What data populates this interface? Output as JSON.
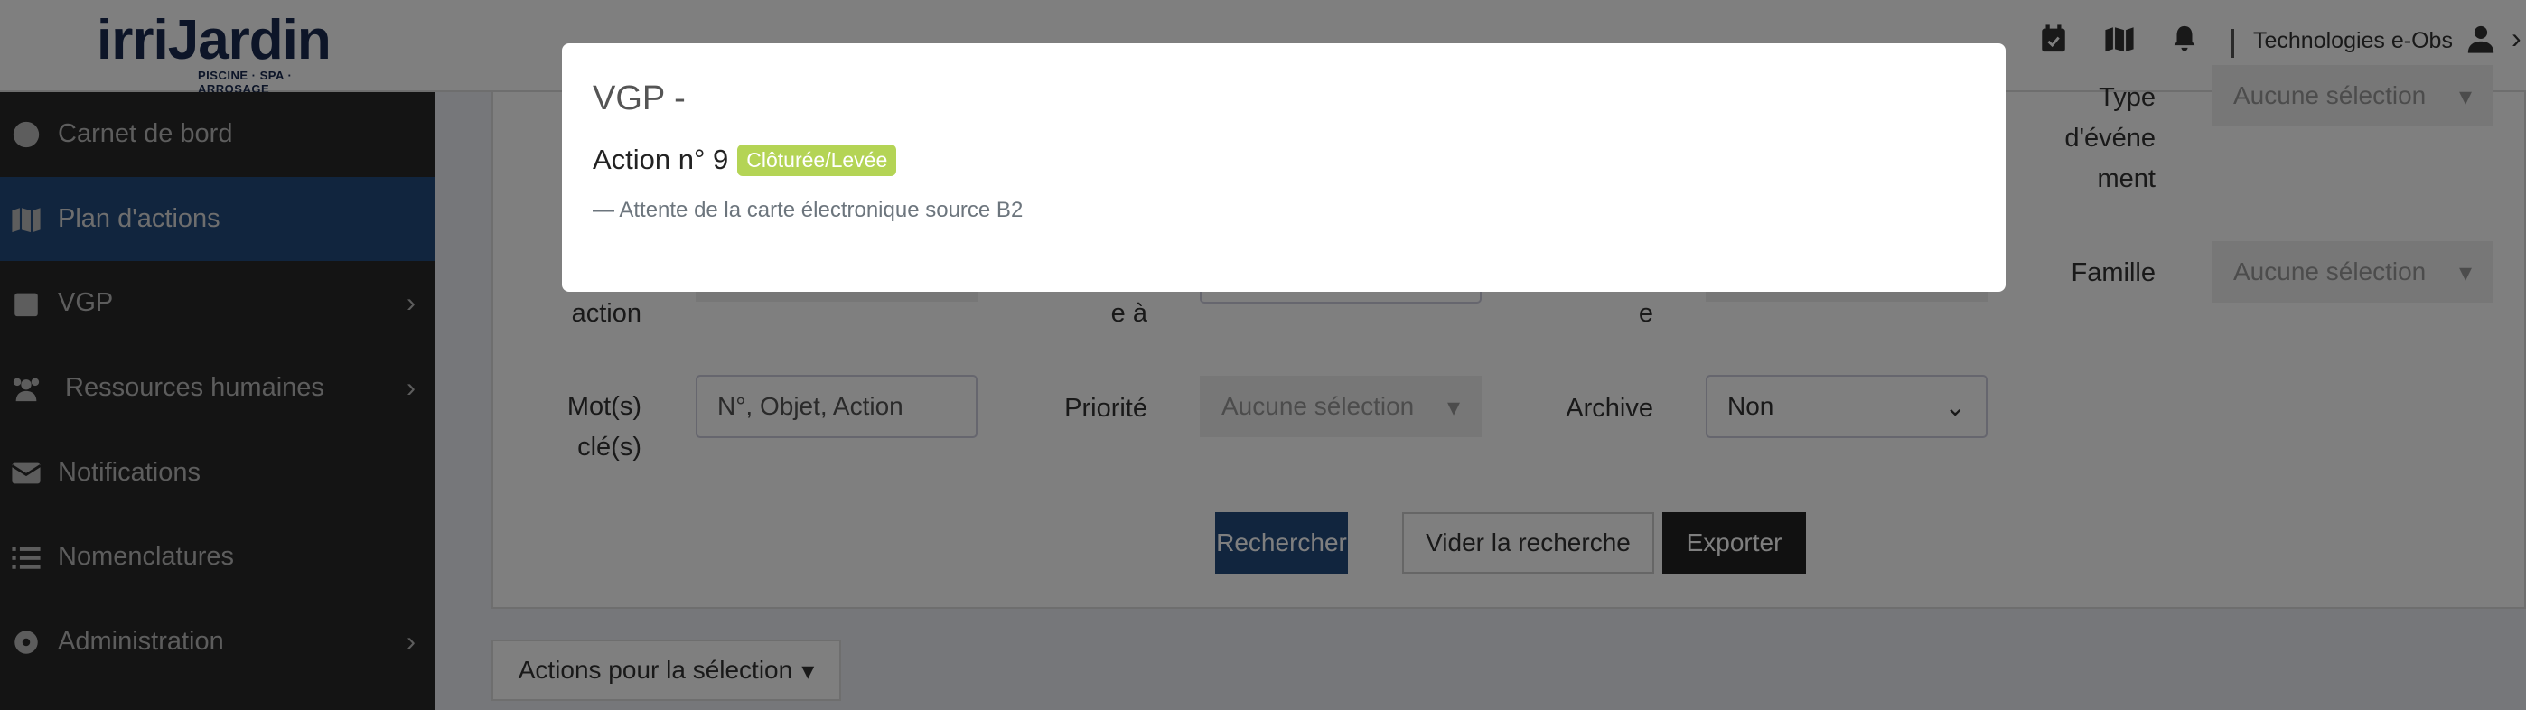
{
  "header": {
    "logo": "irriJardin",
    "logo_sub": "PISCINE · SPA · ARROSAGE",
    "user": "Technologies e-Obs",
    "icons": [
      "calendar-check-icon",
      "map-icon",
      "bell-icon",
      "user-icon",
      "chevron-right-icon"
    ]
  },
  "sidebar": {
    "items": [
      {
        "label": "Carnet de bord",
        "icon": "tachometer-icon"
      },
      {
        "label": "Plan d'actions",
        "icon": "map-icon",
        "active": true
      },
      {
        "label": "VGP",
        "icon": "calendar-check-icon",
        "chevron": true
      },
      {
        "label": "Ressources humaines",
        "icon": "users-icon",
        "chevron": true
      },
      {
        "label": "Notifications",
        "icon": "envelope-icon"
      },
      {
        "label": "Nomenclatures",
        "icon": "list-icon"
      },
      {
        "label": "Administration",
        "icon": "gear-icon",
        "chevron": true
      }
    ]
  },
  "form": {
    "type_label": "Type d'événe ment",
    "type_value": "Aucune sélection",
    "action_label": "action",
    "date_label": "e à",
    "e_label": "e",
    "famille_label": "Famille",
    "famille_value": "Aucune sélection",
    "keywords_label": "Mot(s) clé(s)",
    "keywords_placeholder": "N°, Objet, Action",
    "priorite_label": "Priorité",
    "priorite_value": "Aucune sélection",
    "archive_label": "Archive",
    "archive_value": "Non",
    "search_button": "Rechercher",
    "clear_button": "Vider la recherche",
    "export_button": "Exporter"
  },
  "selection_actions": "Actions pour la sélection",
  "modal": {
    "title": "VGP -",
    "action": "Action n° 9",
    "status": "Clôturée/Levée",
    "status_color": "#b4d455",
    "text": "—  Attente de la carte électronique source B2"
  }
}
